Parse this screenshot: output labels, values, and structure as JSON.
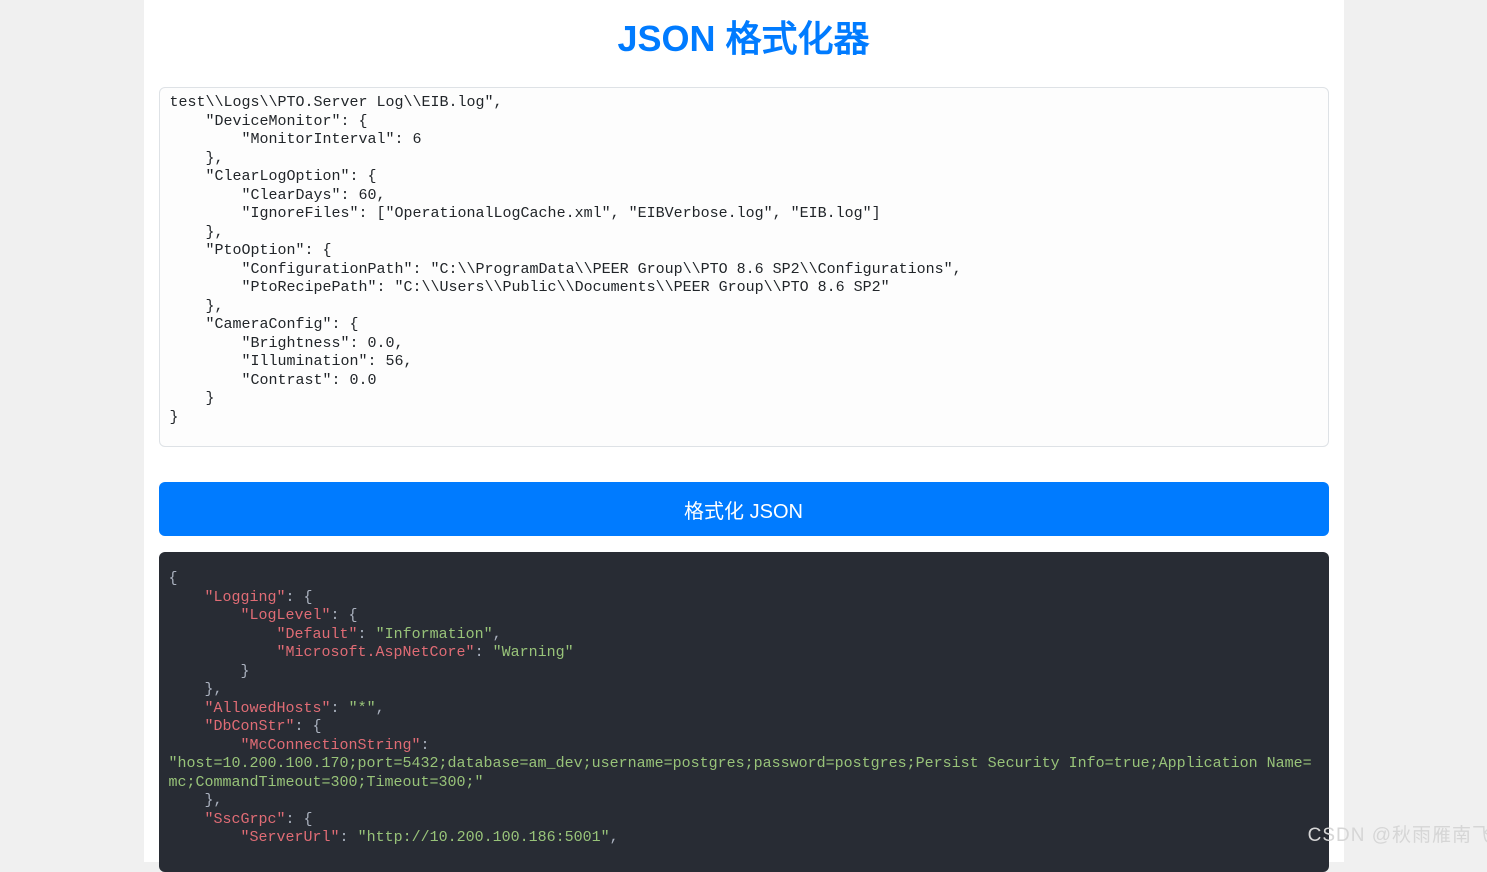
{
  "header": {
    "title": "JSON 格式化器"
  },
  "input": {
    "value": "test\\\\Logs\\\\PTO.Server Log\\\\EIB.log\",\n    \"DeviceMonitor\": {\n        \"MonitorInterval\": 6\n    },\n    \"ClearLogOption\": {\n        \"ClearDays\": 60,\n        \"IgnoreFiles\": [\"OperationalLogCache.xml\", \"EIBVerbose.log\", \"EIB.log\"]\n    },\n    \"PtoOption\": {\n        \"ConfigurationPath\": \"C:\\\\ProgramData\\\\PEER Group\\\\PTO 8.6 SP2\\\\Configurations\",\n        \"PtoRecipePath\": \"C:\\\\Users\\\\Public\\\\Documents\\\\PEER Group\\\\PTO 8.6 SP2\"\n    },\n    \"CameraConfig\": {\n        \"Brightness\": 0.0,\n        \"Illumination\": 56,\n        \"Contrast\": 0.0\n    }\n}"
  },
  "button": {
    "format_label": "格式化 JSON"
  },
  "output": {
    "tokens": [
      {
        "t": "punct",
        "v": "{",
        "indent": 0,
        "nl": true
      },
      {
        "t": "key",
        "v": "\"Logging\"",
        "indent": 4
      },
      {
        "t": "punct",
        "v": ": {",
        "nl": true
      },
      {
        "t": "key",
        "v": "\"LogLevel\"",
        "indent": 8
      },
      {
        "t": "punct",
        "v": ": {",
        "nl": true
      },
      {
        "t": "key",
        "v": "\"Default\"",
        "indent": 12
      },
      {
        "t": "punct",
        "v": ": "
      },
      {
        "t": "str",
        "v": "\"Information\""
      },
      {
        "t": "punct",
        "v": ",",
        "nl": true
      },
      {
        "t": "key",
        "v": "\"Microsoft.AspNetCore\"",
        "indent": 12
      },
      {
        "t": "punct",
        "v": ": "
      },
      {
        "t": "str",
        "v": "\"Warning\"",
        "nl": true
      },
      {
        "t": "punct",
        "v": "}",
        "indent": 8,
        "nl": true
      },
      {
        "t": "punct",
        "v": "},",
        "indent": 4,
        "nl": true
      },
      {
        "t": "key",
        "v": "\"AllowedHosts\"",
        "indent": 4
      },
      {
        "t": "punct",
        "v": ": "
      },
      {
        "t": "str",
        "v": "\"*\""
      },
      {
        "t": "punct",
        "v": ",",
        "nl": true
      },
      {
        "t": "key",
        "v": "\"DbConStr\"",
        "indent": 4
      },
      {
        "t": "punct",
        "v": ": {",
        "nl": true
      },
      {
        "t": "key",
        "v": "\"McConnectionString\"",
        "indent": 8
      },
      {
        "t": "punct",
        "v": ": ",
        "nl": true
      },
      {
        "t": "str",
        "v": "\"host=10.200.100.170;port=5432;database=am_dev;username=postgres;password=postgres;Persist Security Info=true;Application Name=mc;CommandTimeout=300;Timeout=300;\"",
        "indent": 0,
        "nl": true
      },
      {
        "t": "punct",
        "v": "},",
        "indent": 4,
        "nl": true
      },
      {
        "t": "key",
        "v": "\"SscGrpc\"",
        "indent": 4
      },
      {
        "t": "punct",
        "v": ": {",
        "nl": true
      },
      {
        "t": "key",
        "v": "\"ServerUrl\"",
        "indent": 8
      },
      {
        "t": "punct",
        "v": ": "
      },
      {
        "t": "str",
        "v": "\"http://10.200.100.186:5001\""
      },
      {
        "t": "punct",
        "v": ","
      }
    ]
  },
  "watermark": "CSDN @秋雨雁南飞"
}
